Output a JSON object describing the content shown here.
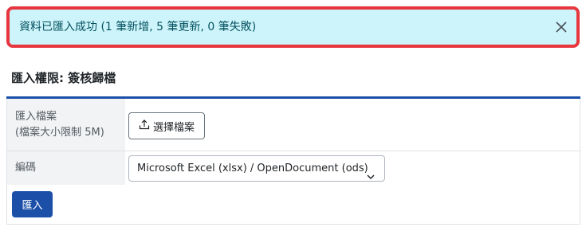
{
  "alert": {
    "message": "資料已匯入成功 (1 筆新增, 5 筆更新, 0 筆失敗)",
    "close_icon": "close-icon",
    "colors": {
      "border": "#e8363f",
      "background": "#cdf4fa",
      "text": "#055160"
    }
  },
  "section": {
    "title": "匯入權限: 簽核歸檔"
  },
  "form": {
    "file_label": "匯入檔案",
    "file_hint": "(檔案大小限制 5M)",
    "file_button_label": "選擇檔案",
    "file_button_icon": "upload-icon",
    "encoding_label": "編碼",
    "encoding_selected": "Microsoft Excel (xlsx) / OpenDocument (ods)",
    "encoding_icon": "chevron-down-icon",
    "submit_label": "匯入"
  },
  "colors": {
    "accent": "#1b4fa8",
    "label_bg": "#f1f3f5"
  }
}
